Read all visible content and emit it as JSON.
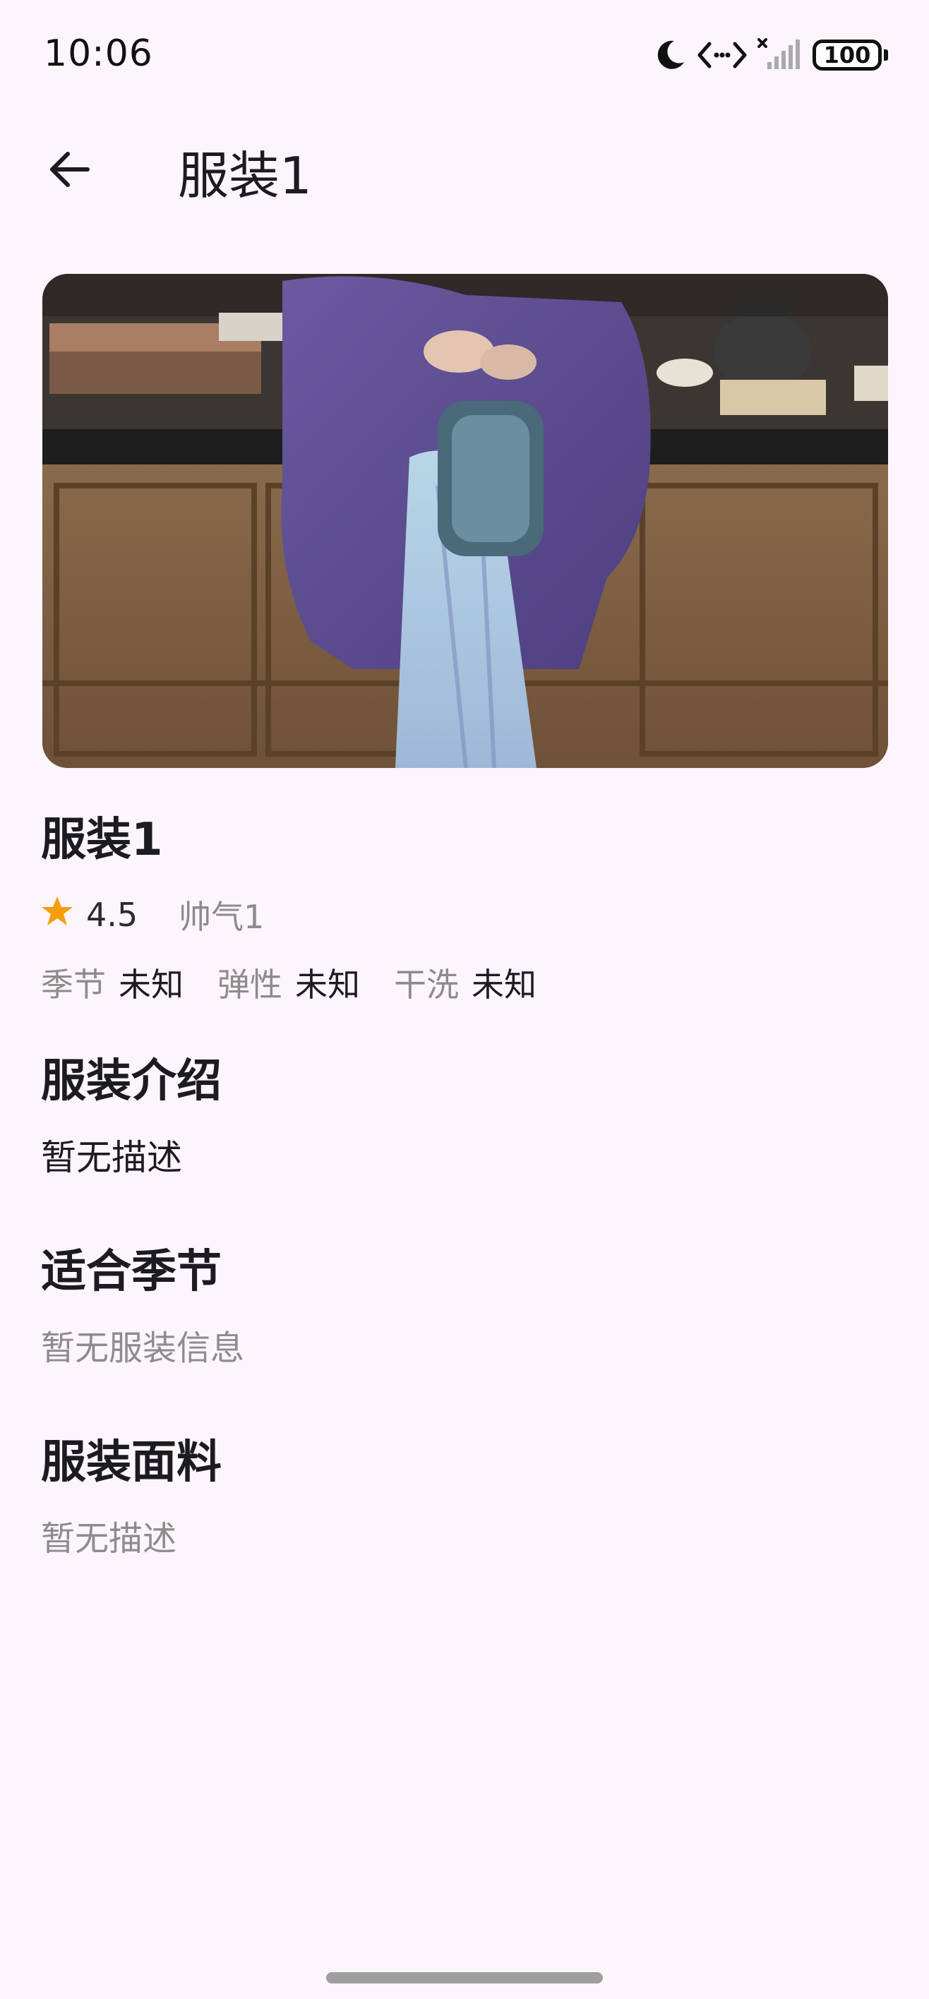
{
  "status_bar": {
    "time": "10:06",
    "battery": "100",
    "icons": [
      "moon-icon",
      "data-arrows-icon",
      "signal-icon",
      "battery-icon"
    ]
  },
  "app_bar": {
    "back_icon": "arrow-left-icon",
    "title": "服装1"
  },
  "hero_image": {
    "description_icon": "clothing-photo"
  },
  "item": {
    "title": "服装1",
    "rating": "4.5",
    "style_tag": "帅气1",
    "attributes": [
      {
        "label": "季节",
        "value": "未知"
      },
      {
        "label": "弹性",
        "value": "未知"
      },
      {
        "label": "干洗",
        "value": "未知"
      }
    ]
  },
  "sections": {
    "intro": {
      "title": "服装介绍",
      "body": "暂无描述"
    },
    "season": {
      "title": "适合季节",
      "body": "暂无服装信息"
    },
    "fabric": {
      "title": "服装面料",
      "body": "暂无描述"
    }
  },
  "colors": {
    "background": "#fcf5fc",
    "star": "#f59e0b",
    "muted_text": "#8c8c8c"
  }
}
